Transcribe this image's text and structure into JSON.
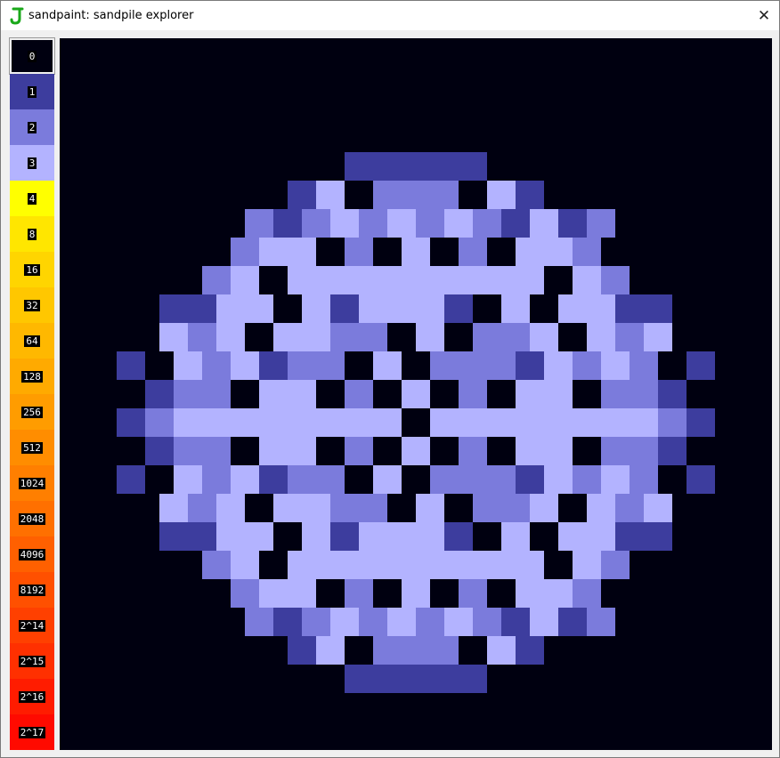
{
  "window": {
    "title": "sandpaint: sandpile explorer",
    "icon": "j-app-icon",
    "close_glyph": "✕"
  },
  "palette": {
    "selected_index": 0,
    "items": [
      {
        "label": "0",
        "color": "#000010"
      },
      {
        "label": "1",
        "color": "#3d3d9e"
      },
      {
        "label": "2",
        "color": "#7b7bdc"
      },
      {
        "label": "3",
        "color": "#b3b3ff"
      },
      {
        "label": "4",
        "color": "#ffff00"
      },
      {
        "label": "8",
        "color": "#ffe600"
      },
      {
        "label": "16",
        "color": "#ffd500"
      },
      {
        "label": "32",
        "color": "#ffc700"
      },
      {
        "label": "64",
        "color": "#ffb800"
      },
      {
        "label": "128",
        "color": "#ffaa00"
      },
      {
        "label": "256",
        "color": "#ff9c00"
      },
      {
        "label": "512",
        "color": "#ff8d00"
      },
      {
        "label": "1024",
        "color": "#ff7f00"
      },
      {
        "label": "2048",
        "color": "#ff7000"
      },
      {
        "label": "4096",
        "color": "#ff6000"
      },
      {
        "label": "8192",
        "color": "#ff5000"
      },
      {
        "label": "2^14",
        "color": "#ff4000"
      },
      {
        "label": "2^15",
        "color": "#ff3000"
      },
      {
        "label": "2^16",
        "color": "#ff1c00"
      },
      {
        "label": "2^17",
        "color": "#ff0a00"
      }
    ]
  },
  "sandpile": {
    "background": "#000010",
    "grid_size": 25,
    "rows": [
      ".........................",
      ".........................",
      ".........................",
      ".......................",
      "..........11111..........",
      "........13.222.31........",
      ".......2123232321312......",
      "......233.2.3.2.332......",
      ".....23.333333333.32.....",
      "....1133.313331.3.3311....",
      "....323.3322.3.223.323....",
      "...1.323122.3.22213232.1...",
      "...122.33.2.3.2.33.221...",
      "...1233333333.3333333321...",
      "...122.33.2.3.2.33.221...",
      "...1.323122.3.22213232.1...",
      "....323.3322.3.223.323....",
      "....1133.313331.3.3311....",
      ".....23.333333333.32.....",
      "......233.2.3.2.332......",
      ".......2123232321312......",
      "........13.222.31........",
      "..........11111..........",
      ".........................",
      "........................."
    ]
  }
}
